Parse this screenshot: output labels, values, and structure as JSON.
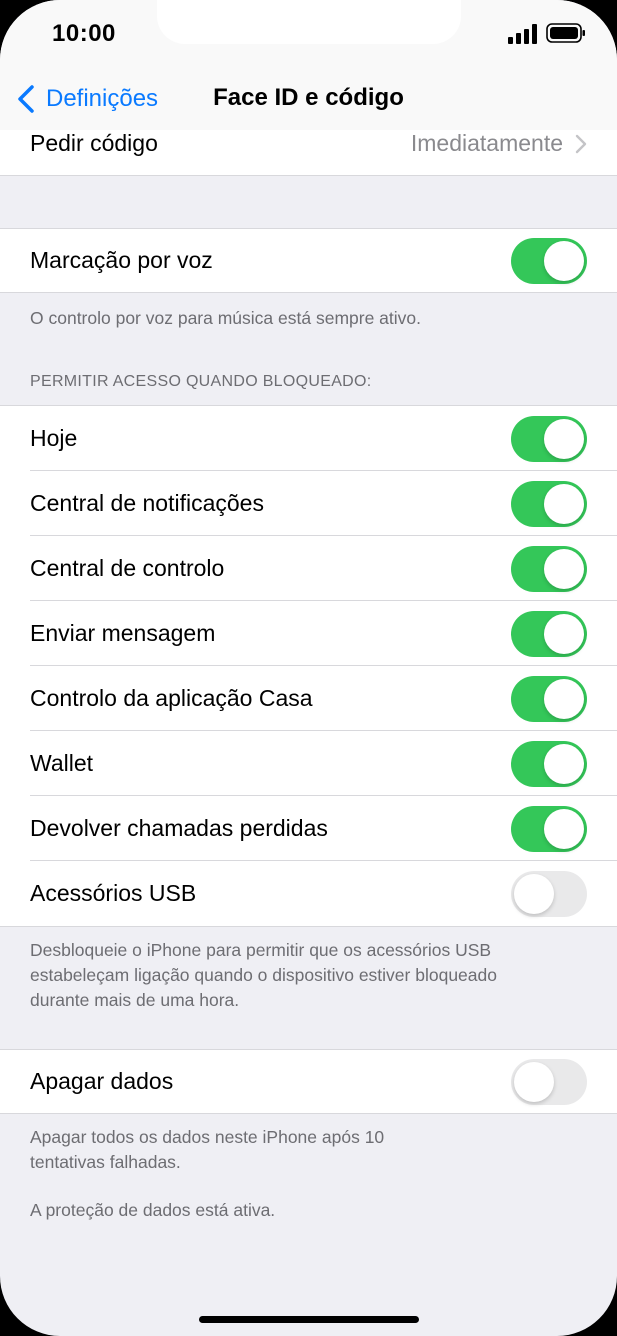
{
  "status": {
    "time": "10:00"
  },
  "nav": {
    "back_label": "Definições",
    "title": "Face ID e código"
  },
  "passcode": {
    "label": "Pedir código",
    "value": "Imediatamente"
  },
  "voice": {
    "label": "Marcação por voz",
    "on": true,
    "footer": "O controlo por voz para música está sempre ativo."
  },
  "locked_access": {
    "header": "PERMITIR ACESSO QUANDO BLOQUEADO:",
    "items": [
      {
        "label": "Hoje",
        "on": true
      },
      {
        "label": "Central de notificações",
        "on": true
      },
      {
        "label": "Central de controlo",
        "on": true
      },
      {
        "label": "Enviar mensagem",
        "on": true
      },
      {
        "label": "Controlo da aplicação Casa",
        "on": true
      },
      {
        "label": "Wallet",
        "on": true
      },
      {
        "label": "Devolver chamadas perdidas",
        "on": true
      },
      {
        "label": "Acessórios USB",
        "on": false
      }
    ],
    "footer_line1": "Desbloqueie o iPhone para permitir que os acessórios USB",
    "footer_line2": "estabeleçam ligação quando o dispositivo estiver bloqueado",
    "footer_line3": "durante mais de uma hora."
  },
  "erase": {
    "label": "Apagar dados",
    "on": false,
    "footer_line1": "Apagar todos os dados neste iPhone após 10",
    "footer_line2": "tentativas falhadas.",
    "footer_note": "A proteção de dados está ativa."
  },
  "colors": {
    "accent": "#0a7aff",
    "toggle_on": "#34c759",
    "toggle_off": "#e9e9ea",
    "background": "#efeff4"
  }
}
